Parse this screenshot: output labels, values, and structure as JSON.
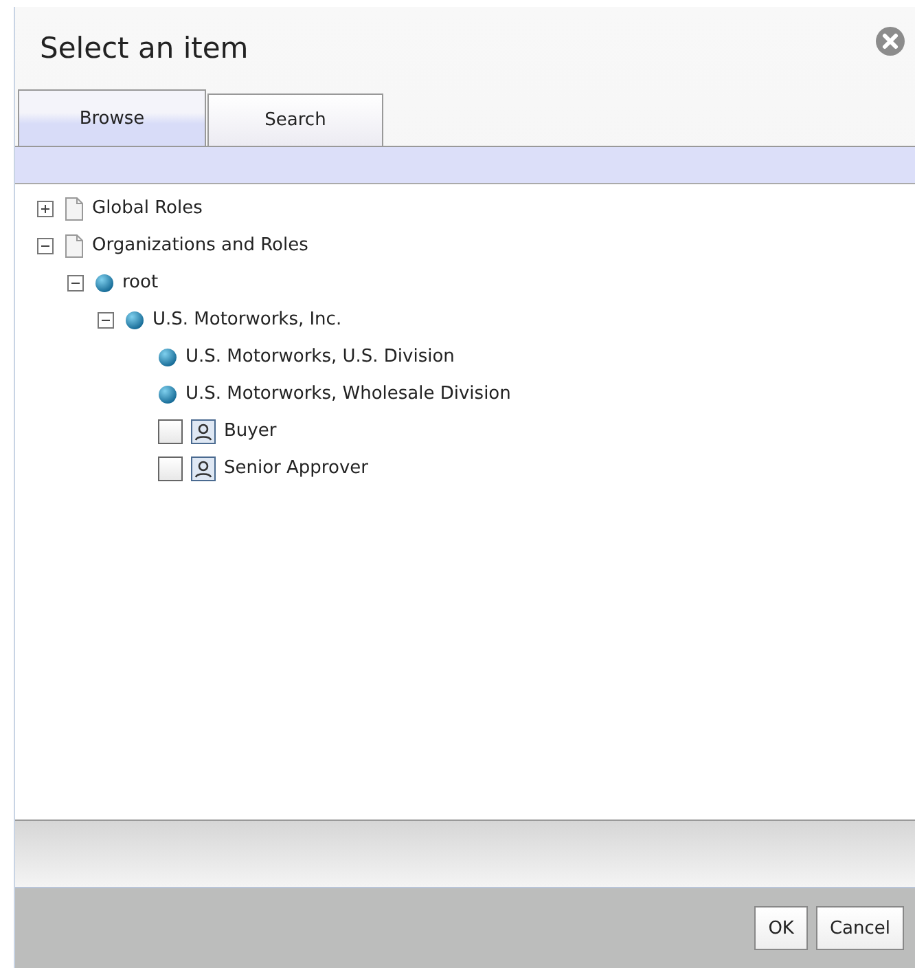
{
  "dialog": {
    "title": "Select an item"
  },
  "tabs": [
    {
      "label": "Browse",
      "selected": true
    },
    {
      "label": "Search",
      "selected": false
    }
  ],
  "tree": [
    {
      "kind": "folder",
      "label": "Global Roles",
      "expanded": false
    },
    {
      "kind": "folder",
      "label": "Organizations and Roles",
      "expanded": true,
      "children": [
        {
          "kind": "org",
          "label": "root",
          "expanded": true,
          "children": [
            {
              "kind": "org",
              "label": "U.S. Motorworks, Inc.",
              "expanded": true,
              "children": [
                {
                  "kind": "org",
                  "label": "U.S. Motorworks, U.S. Division"
                },
                {
                  "kind": "org",
                  "label": "U.S. Motorworks, Wholesale Division"
                },
                {
                  "kind": "role",
                  "label": "Buyer",
                  "checked": false
                },
                {
                  "kind": "role",
                  "label": "Senior Approver",
                  "checked": false
                }
              ]
            }
          ]
        }
      ]
    }
  ],
  "buttons": [
    {
      "label": "OK"
    },
    {
      "label": "Cancel"
    }
  ]
}
